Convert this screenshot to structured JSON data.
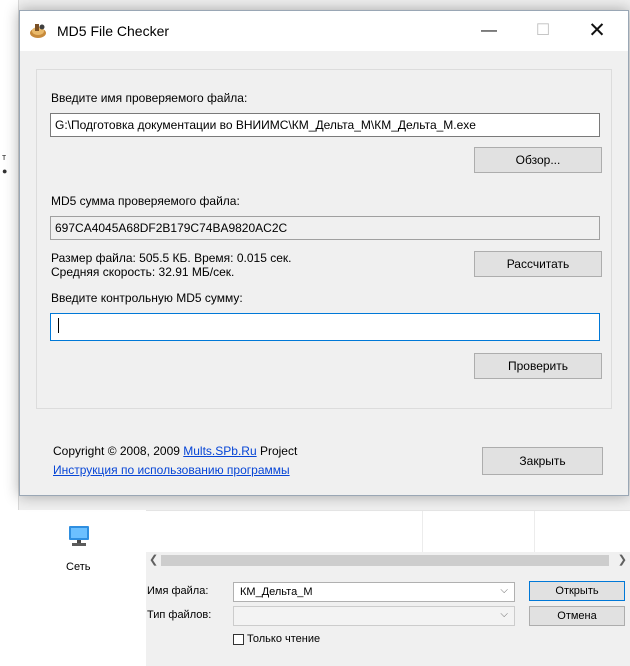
{
  "md5_window": {
    "title": "MD5 File Checker",
    "controls": {
      "minimize": "—",
      "maximize": "☐",
      "close": "✕"
    },
    "file_label": "Введите имя проверяемого файла:",
    "file_path": "G:\\Подготовка документации во ВНИИМС\\КМ_Дельта_М\\КМ_Дельта_М.exe",
    "browse_button": "Обзор...",
    "md5_label": "MD5 сумма проверяемого файла:",
    "md5_value": "697CA4045A68DF2B179C74BA9820AC2C",
    "stats_line1": "Размер файла: 505.5 КБ. Время: 0.015 сек.",
    "stats_line2": "Средняя скорость: 32.91 МБ/сек.",
    "calculate_button": "Рассчитать",
    "control_md5_label": "Введите контрольную MD5 сумму:",
    "control_md5_value": "",
    "check_button": "Проверить",
    "copyright_prefix": "Copyright © 2008, 2009 ",
    "copyright_link": "Mults.SPb.Ru",
    "copyright_suffix": " Project",
    "instructions_link": "Инструкция по использованию программы",
    "close_button": "Закрыть"
  },
  "open_dialog": {
    "network_label": "Сеть",
    "filename_label": "Имя файла:",
    "filename_value": "КМ_Дельта_М",
    "filetype_label": "Тип файлов:",
    "filetype_value": "",
    "open_button": "Открыть",
    "cancel_button": "Отмена",
    "readonly_label": "Только чтение",
    "readonly_checked": false
  },
  "colors": {
    "link": "#0645d6",
    "focus_border": "#0078d7",
    "button_face": "#e1e1e1",
    "dialog_bg": "#f0f0f0"
  },
  "icons": {
    "app": "md5-checker-app-icon",
    "network": "network-computer-icon"
  }
}
